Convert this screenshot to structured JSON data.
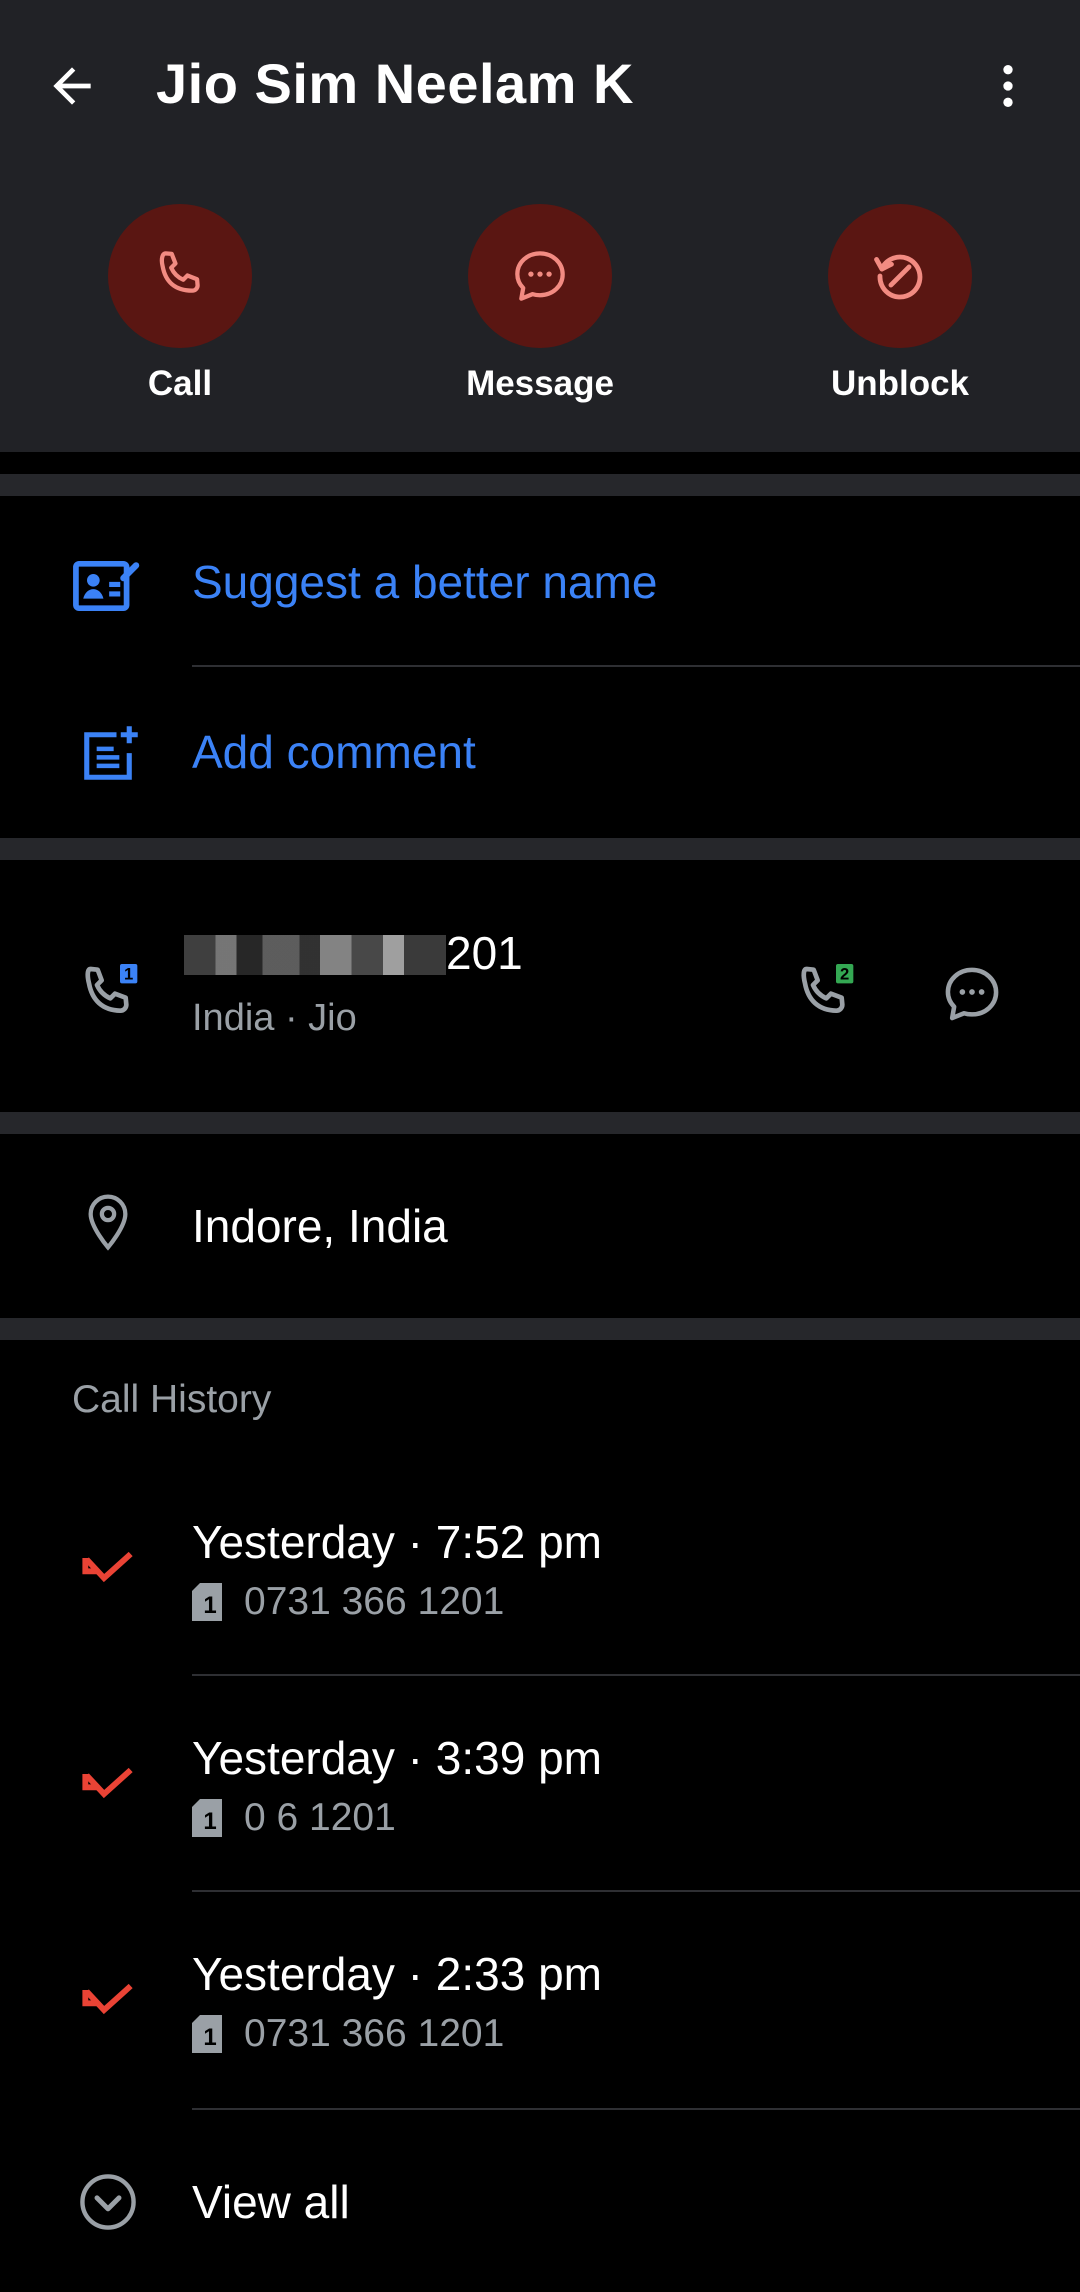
{
  "header": {
    "title": "Jio Sim Neelam K",
    "back_icon": "arrow-back-icon",
    "more_icon": "more-vert-icon"
  },
  "actions": [
    {
      "label": "Call",
      "icon": "phone-icon"
    },
    {
      "label": "Message",
      "icon": "chat-bubble-icon"
    },
    {
      "label": "Unblock",
      "icon": "unblock-icon"
    }
  ],
  "links": {
    "suggest_name": "Suggest a better name",
    "add_comment": "Add comment"
  },
  "number": {
    "visible_suffix": "201",
    "carrier": "India · Jio",
    "sim1_badge": "1",
    "sim2_badge": "2"
  },
  "location": {
    "text": "Indore, India"
  },
  "call_history": {
    "title": "Call History",
    "entries": [
      {
        "time": "Yesterday · 7:52 pm",
        "number": "0731 366 1201",
        "sim": "1",
        "type": "missed"
      },
      {
        "time": "Yesterday · 3:39 pm",
        "number": "0 6 1201",
        "sim": "1",
        "type": "missed"
      },
      {
        "time": "Yesterday · 2:33 pm",
        "number": "0731 366 1201",
        "sim": "1",
        "type": "missed"
      }
    ],
    "view_all": "View all"
  },
  "colors": {
    "header_bg": "#212226",
    "action_circle": "#5a1612",
    "action_icon": "#f28b82",
    "link_blue": "#3b82f6",
    "missed_red": "#ea4335",
    "sim2_green": "#34a853"
  }
}
